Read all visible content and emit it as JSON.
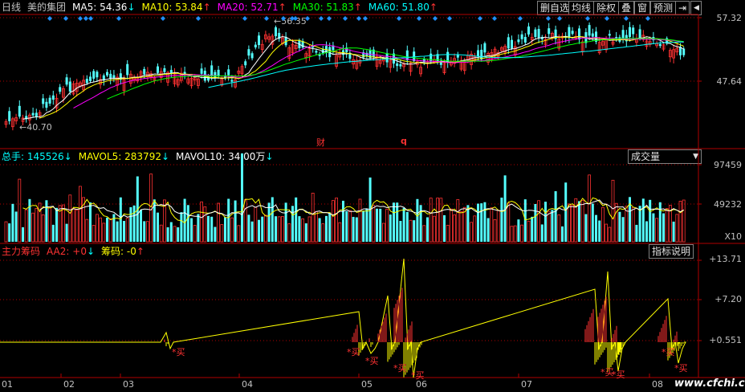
{
  "header": {
    "period": "日线",
    "stock": "美的集团",
    "ma5": {
      "label": "MA5: 54.36",
      "arrow": "↓",
      "color": "#ffffff"
    },
    "ma10": {
      "label": "MA10: 53.84",
      "arrow": "↑",
      "color": "#ffff00"
    },
    "ma20": {
      "label": "MA20: 52.71",
      "arrow": "↑",
      "color": "#ff00ff"
    },
    "ma30": {
      "label": "MA30: 51.83",
      "arrow": "↑",
      "color": "#00ff00"
    },
    "ma60": {
      "label": "MA60: 51.80",
      "arrow": "↑",
      "color": "#00ffff"
    }
  },
  "toolbar": {
    "del_watch": "删自选",
    "ma_line": "均线",
    "ex_right": "除权",
    "overlay": "叠",
    "window": "窗",
    "predict": "预测"
  },
  "price_axis": {
    "top": "57.32",
    "mid": "47.64"
  },
  "annotations": {
    "high": "56.35",
    "low": "40.70",
    "cai": "财",
    "q": "q"
  },
  "volume_header": {
    "total": "总手: 145526",
    "total_arrow": "↓",
    "mavol5": "MAVOL5: 283792",
    "mavol5_arrow": "↓",
    "mavol10": "MAVOL10: 34.00万",
    "mavol10_arrow": "↓",
    "selector": "成交量"
  },
  "volume_axis": {
    "top": "97459",
    "mid": "49232",
    "unit": "X10"
  },
  "indicator_header": {
    "name": "主力筹码",
    "aa2": "AA2: +0",
    "aa2_arrow": "↓",
    "chip": "筹码: -0",
    "chip_arrow": "↑",
    "help_button": "指标说明"
  },
  "indicator_axis": {
    "a": "+13.71",
    "b": "+7.20",
    "c": "+0.551"
  },
  "buy_label": "*买",
  "months": [
    "01",
    "02",
    "03",
    "04",
    "05",
    "06",
    "07",
    "08"
  ],
  "watermark": "www.cfchi.com",
  "colors": {
    "up": "#ff3232",
    "down": "#54ffff",
    "grid": "#b00000",
    "axis_text": "#c0c0c0"
  }
}
